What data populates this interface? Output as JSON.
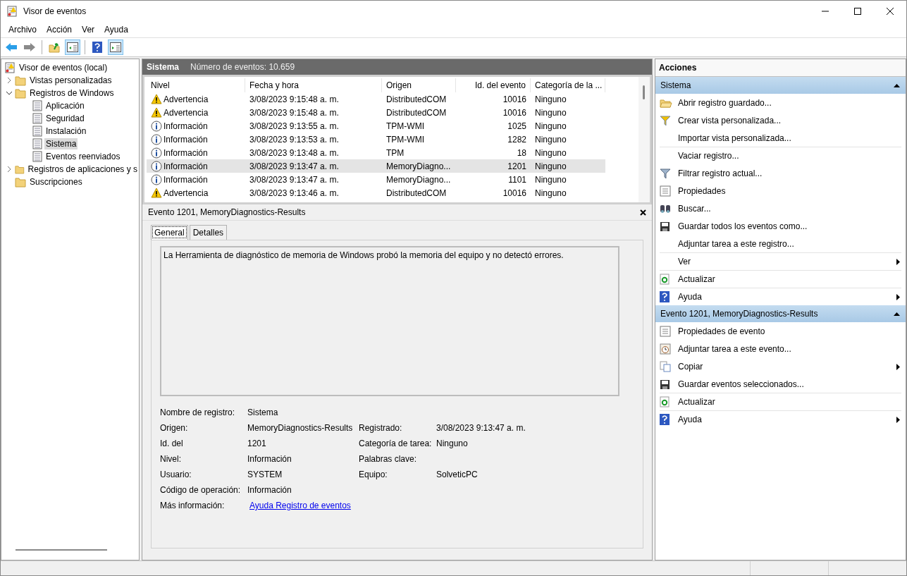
{
  "window": {
    "title": "Visor de eventos"
  },
  "menu": [
    "Archivo",
    "Acción",
    "Ver",
    "Ayuda"
  ],
  "tree": [
    {
      "label": "Visor de eventos (local)",
      "selected": false,
      "children": [
        {
          "label": "Vistas personalizadas",
          "expanded": false,
          "selected": false
        },
        {
          "label": "Registros de Windows",
          "expanded": true,
          "selected": false,
          "children": [
            {
              "label": "Aplicación",
              "selected": false
            },
            {
              "label": "Seguridad",
              "selected": false
            },
            {
              "label": "Instalación",
              "selected": false
            },
            {
              "label": "Sistema",
              "selected": true
            },
            {
              "label": "Eventos reenviados",
              "selected": false
            }
          ]
        },
        {
          "label": "Registros de aplicaciones y s",
          "expanded": false,
          "selected": false
        },
        {
          "label": "Suscripciones",
          "selected": false
        }
      ]
    }
  ],
  "log_header": {
    "title": "Sistema",
    "count": "Número de eventos: 10.659"
  },
  "table": {
    "columns": [
      "Nivel",
      "Fecha y hora",
      "Origen",
      "Id. del evento",
      "Categoría de la ..."
    ],
    "rows": [
      {
        "kind": "warning",
        "level": "Advertencia",
        "date": "3/08/2023 9:15:48 a. m.",
        "source": "DistributedCOM",
        "id": "10016",
        "category": "Ninguno",
        "selected": false
      },
      {
        "kind": "warning",
        "level": "Advertencia",
        "date": "3/08/2023 9:15:48 a. m.",
        "source": "DistributedCOM",
        "id": "10016",
        "category": "Ninguno",
        "selected": false
      },
      {
        "kind": "info",
        "level": "Información",
        "date": "3/08/2023 9:13:55 a. m.",
        "source": "TPM-WMI",
        "id": "1025",
        "category": "Ninguno",
        "selected": false
      },
      {
        "kind": "info",
        "level": "Información",
        "date": "3/08/2023 9:13:53 a. m.",
        "source": "TPM-WMI",
        "id": "1282",
        "category": "Ninguno",
        "selected": false
      },
      {
        "kind": "info",
        "level": "Información",
        "date": "3/08/2023 9:13:48 a. m.",
        "source": "TPM",
        "id": "18",
        "category": "Ninguno",
        "selected": false
      },
      {
        "kind": "info",
        "level": "Información",
        "date": "3/08/2023 9:13:47 a. m.",
        "source": "MemoryDiagno...",
        "id": "1201",
        "category": "Ninguno",
        "selected": true
      },
      {
        "kind": "info",
        "level": "Información",
        "date": "3/08/2023 9:13:47 a. m.",
        "source": "MemoryDiagno...",
        "id": "1101",
        "category": "Ninguno",
        "selected": false
      },
      {
        "kind": "warning",
        "level": "Advertencia",
        "date": "3/08/2023 9:13:46 a. m.",
        "source": "DistributedCOM",
        "id": "10016",
        "category": "Ninguno",
        "selected": false
      }
    ]
  },
  "detail": {
    "title": "Evento 1201, MemoryDiagnostics-Results",
    "tabs": [
      {
        "label": "General",
        "selected": true
      },
      {
        "label": "Detalles",
        "selected": false
      }
    ],
    "description": "La Herramienta de diagnóstico de memoria de Windows probó la memoria del equipo y no detectó errores.",
    "fields": [
      {
        "label": "Nombre de registro:",
        "value": "Sistema"
      },
      {
        "label": "Origen:",
        "value": "MemoryDiagnostics-Results",
        "label_2": "Registrado:",
        "value_2": "3/08/2023 9:13:47 a. m."
      },
      {
        "label": "Id. del",
        "value": "1201",
        "label_2": "Categoría de tarea:",
        "value_2": "Ninguno"
      },
      {
        "label": "Nivel:",
        "value": "Información",
        "label_2": "Palabras clave:"
      },
      {
        "label": "Usuario:",
        "value": "SYSTEM",
        "label_2": "Equipo:",
        "value_2": "SolveticPC"
      },
      {
        "label": "Código de operación:",
        "value": "Información"
      },
      {
        "label": "Más información:",
        "link": "Ayuda Registro de eventos"
      }
    ]
  },
  "actions": {
    "title": "Acciones",
    "sections": [
      {
        "title": "Sistema",
        "items": [
          {
            "label": "Abrir registro guardado...",
            "divider_above": false,
            "submenu": false
          },
          {
            "label": "Crear vista personalizada...",
            "divider_above": false,
            "submenu": false
          },
          {
            "label": "Importar vista personalizada...",
            "divider_above": false,
            "submenu": false
          },
          {
            "label": "Vaciar registro...",
            "divider_above": true,
            "submenu": false
          },
          {
            "label": "Filtrar registro actual...",
            "divider_above": false,
            "submenu": false
          },
          {
            "label": "Propiedades",
            "divider_above": false,
            "submenu": false
          },
          {
            "label": "Buscar...",
            "divider_above": false,
            "submenu": false
          },
          {
            "label": "Guardar todos los eventos como...",
            "divider_above": false,
            "submenu": false
          },
          {
            "label": "Adjuntar tarea a este registro...",
            "divider_above": false,
            "submenu": false
          },
          {
            "label": "Ver",
            "divider_above": true,
            "submenu": true
          },
          {
            "label": "Actualizar",
            "divider_above": true,
            "submenu": false
          },
          {
            "label": "Ayuda",
            "divider_above": true,
            "submenu": true
          }
        ]
      },
      {
        "title": "Evento 1201, MemoryDiagnostics-Results",
        "items": [
          {
            "label": "Propiedades de evento",
            "divider_above": false,
            "submenu": false
          },
          {
            "label": "Adjuntar tarea a este evento...",
            "divider_above": false,
            "submenu": false
          },
          {
            "label": "Copiar",
            "divider_above": false,
            "submenu": true
          },
          {
            "label": "Guardar eventos seleccionados...",
            "divider_above": false,
            "submenu": false
          },
          {
            "label": "Actualizar",
            "divider_above": true,
            "submenu": false
          },
          {
            "label": "Ayuda",
            "divider_above": true,
            "submenu": true
          }
        ]
      }
    ]
  }
}
